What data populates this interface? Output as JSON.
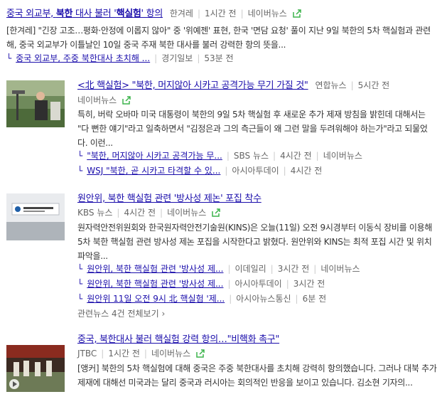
{
  "colors": {
    "link": "#1a0dab",
    "meta": "#666666",
    "share": "#3cb44b"
  },
  "items": [
    {
      "title_pre": "중국 외교부, ",
      "title_bold1": "북한",
      "title_mid": " 대사 불러 '",
      "title_bold2": "핵실험",
      "title_post": "' 항의",
      "source": "한겨레",
      "time": "1시간 전",
      "portal": "네이버뉴스",
      "snippet": "[한겨레] \"긴장 고조…평화·안정에 이롭지 않아\" 중 '위예젠' 표현, 한국 '면담 요청' 풀이 지난 9일 북한의 5차 핵실험과 관련해, 중국 외교부가 이틀날인 10일 중국 주재 북한 대사를 불러 강력한 항의 뜻을...",
      "subs": [
        {
          "title": "중국 외교부, 주중 북한대사 초치해 ...",
          "source": "경기일보",
          "time": "53분 전"
        }
      ]
    },
    {
      "title": "<北 핵실험> \"북한, 머지않아 시카고 공격가능 무기 가질 것\"",
      "source": "연합뉴스",
      "time": "5시간 전",
      "portal": "네이버뉴스",
      "snippet": "특히, 버락 오바마 미국 대통령이 북한의 9일 5차 핵실험 후 새로운 추가 제재 방침을 밝힌데 대해서는 \"다 뻔한 얘기\"라고 일축하면서 \"김정은과 그의 측근들이 왜 그런 말을 두려워해야 하는가\"라고 되물었다. 이런...",
      "subs": [
        {
          "title": "\"북한, 머지않아 시카고 공격가능 무...",
          "source": "SBS 뉴스",
          "time": "4시간 전",
          "portal": "네이버뉴스"
        },
        {
          "title": "WSJ \"북한, 곧 시카고 타격할 수 있...",
          "source": "아시아투데이",
          "time": "4시간 전"
        }
      ]
    },
    {
      "title": "원안위, 북한 핵실험 관련 '방사성 제논' 포집 착수",
      "source": "KBS 뉴스",
      "time": "4시간 전",
      "portal": "네이버뉴스",
      "snippet": "원자력안전위원회와 한국원자력안전기술원(KINS)은 오늘(11일) 오전 9시경부터 이동식 장비를 이용해 5차 북한 핵실험 관련 방사성 제논 포집을 시작한다고 밝혔다. 원안위와 KINS는 최적 포집 시간 및 위치 파악을...",
      "subs": [
        {
          "title": "원안위, 북한 핵실험 관련 '방사성 제...",
          "source": "이데일리",
          "time": "3시간 전",
          "portal": "네이버뉴스"
        },
        {
          "title": "원안위, 북한 핵실험 관련 '방사성 제...",
          "source": "아시아투데이",
          "time": "3시간 전"
        },
        {
          "title": "원안위 11일 오전 9시 北 핵실험 '제...",
          "source": "아시아뉴스통신",
          "time": "6분 전"
        }
      ],
      "more": "관련뉴스 4건 전체보기"
    },
    {
      "title": "중국, 북한대사 불러 핵실험 강력 항의…\"비핵화 촉구\"",
      "source": "JTBC",
      "time": "1시간 전",
      "portal": "네이버뉴스",
      "snippet": "[앵커] 북한의 5차 핵실험에 대해 중국은 주중 북한대사를 초치해 강력히 항의했습니다. 그러나 대북 추가제재에 대해선 미국과는 달리 중국과 러시아는 회의적인 반응을 보이고 있습니다. 김소현 기자의..."
    }
  ]
}
